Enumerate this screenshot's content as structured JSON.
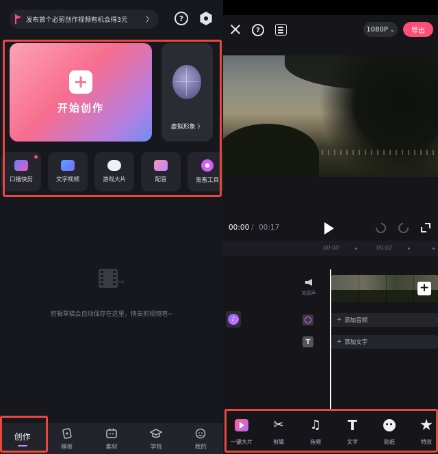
{
  "left": {
    "notice": {
      "text": "发布首个必剪创作视频有机会得3元",
      "chevron": "〉"
    },
    "start": {
      "label": "开始创作",
      "plus": "+"
    },
    "avatar": {
      "label": "虚拟形象 〉"
    },
    "tools": [
      {
        "label": "口播快剪",
        "icon": "tts-icon",
        "badge": true
      },
      {
        "label": "文字视频",
        "icon": "text-video-icon",
        "badge": false
      },
      {
        "label": "游戏大片",
        "icon": "gamepad-icon",
        "badge": false
      },
      {
        "label": "配音",
        "icon": "voiceover-icon",
        "badge": false
      },
      {
        "label": "鬼畜工具",
        "icon": "remix-icon",
        "badge": false
      }
    ],
    "empty": {
      "text": "剪辑草稿会自动保存在这里，快去剪视频吧~"
    },
    "nav": [
      {
        "label": "创作",
        "icon": "create-icon",
        "active": true
      },
      {
        "label": "模板",
        "icon": "template-icon",
        "active": false
      },
      {
        "label": "素材",
        "icon": "material-icon",
        "active": false
      },
      {
        "label": "学院",
        "icon": "academy-icon",
        "active": false
      },
      {
        "label": "我的",
        "icon": "profile-icon",
        "active": false
      }
    ]
  },
  "right": {
    "resolution": "1080P",
    "export_label": "导出",
    "time_current": "00:00",
    "time_sep": "/",
    "time_total": "00:17",
    "ruler": [
      "00:00",
      "00:02"
    ],
    "audio_label": "关原声",
    "add_music": "添加音频",
    "add_text": "添加文字",
    "tools": [
      {
        "label": "一键大片",
        "icon": "one-click-icon"
      },
      {
        "label": "剪辑",
        "icon": "scissors-icon"
      },
      {
        "label": "音频",
        "icon": "music-note-icon"
      },
      {
        "label": "文字",
        "icon": "text-icon"
      },
      {
        "label": "贴纸",
        "icon": "sticker-icon"
      },
      {
        "label": "特效",
        "icon": "effects-icon"
      }
    ]
  },
  "colors": {
    "accent": "#fb4f77",
    "highlight": "#e8483e",
    "bg": "#17171e"
  }
}
